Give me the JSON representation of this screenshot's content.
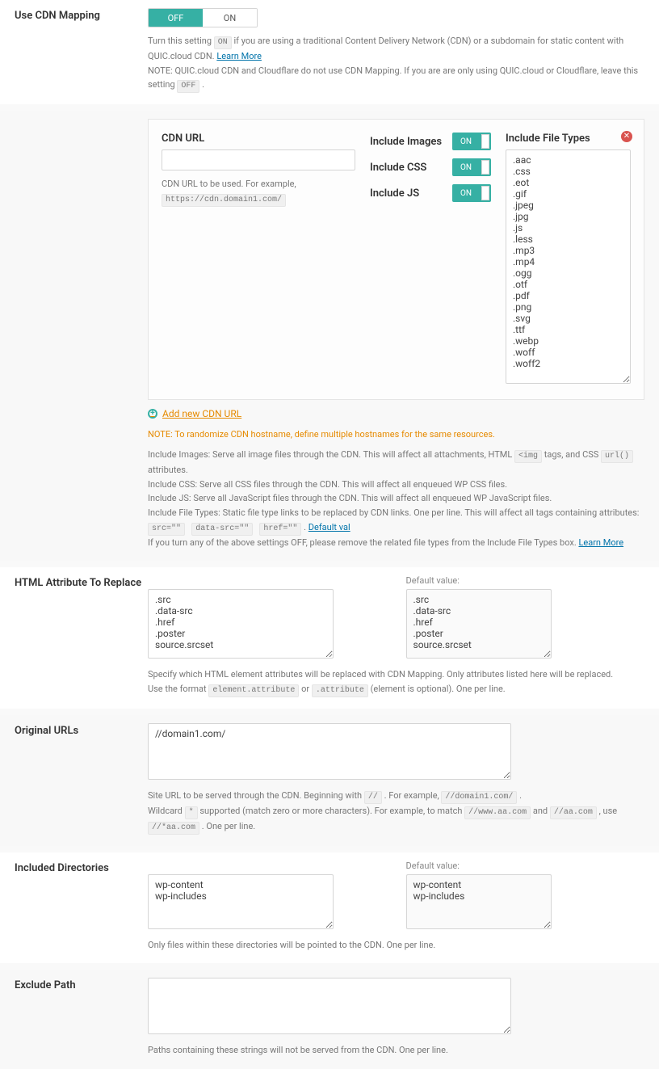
{
  "useCdnMapping": {
    "label": "Use CDN Mapping",
    "off": "OFF",
    "on": "ON",
    "help1_pre": "Turn this setting ",
    "help1_pill": "ON",
    "help1_post": " if you are using a traditional Content Delivery Network (CDN) or a subdomain for static content with QUIC.cloud CDN. ",
    "learnMore": "Learn More",
    "help2_pre": "NOTE: QUIC.cloud CDN and Cloudflare do not use CDN Mapping. If you are are only using QUIC.cloud or Cloudflare, leave this setting ",
    "help2_pill": "OFF",
    "help2_post": " ."
  },
  "cdnBlock": {
    "cdnUrl": {
      "label": "CDN URL",
      "value": "",
      "helpPre": "CDN URL to be used. For example, ",
      "helpCode": "https://cdn.domain1.com/"
    },
    "includeImages": {
      "label": "Include Images",
      "state": "ON"
    },
    "includeCss": {
      "label": "Include CSS",
      "state": "ON"
    },
    "includeJs": {
      "label": "Include JS",
      "state": "ON"
    },
    "includeFileTypes": {
      "label": "Include File Types",
      "value": ".aac\n.css\n.eot\n.gif\n.jpeg\n.jpg\n.js\n.less\n.mp3\n.mp4\n.ogg\n.otf\n.pdf\n.png\n.svg\n.ttf\n.webp\n.woff\n.woff2"
    },
    "addNew": "Add new CDN URL",
    "randomizeNote": "NOTE: To randomize CDN hostname, define multiple hostnames for the same resources.",
    "desc": {
      "images_pre": "Include Images: Serve all image files through the CDN. This will affect all attachments, HTML ",
      "images_code1": "<img",
      "images_mid": " tags, and CSS ",
      "images_code2": "url()",
      "images_post": " attributes.",
      "css": "Include CSS: Serve all CSS files through the CDN. This will affect all enqueued WP CSS files.",
      "js": "Include JS: Serve all JavaScript files through the CDN. This will affect all enqueued WP JavaScript files.",
      "ft_pre": "Include File Types: Static file type links to be replaced by CDN links. One per line. This will affect all tags containing attributes: ",
      "ft_c1": "src=\"\"",
      "ft_c2": "data-src=\"\"",
      "ft_c3": "href=\"\"",
      "ft_post": ". ",
      "defaultVal": "Default val",
      "off_pre": "If you turn any of the above settings OFF, please remove the related file types from the Include File Types box. ",
      "learnMore": "Learn More"
    }
  },
  "htmlAttr": {
    "label": "HTML Attribute To Replace",
    "value": ".src\n.data-src\n.href\n.poster\nsource.srcset",
    "defaultLabel": "Default value:",
    "defaultValue": ".src\n.data-src\n.href\n.poster\nsource.srcset",
    "help1": "Specify which HTML element attributes will be replaced with CDN Mapping. Only attributes listed here will be replaced.",
    "help2_pre": "Use the format ",
    "help2_c1": "element.attribute",
    "help2_mid": " or ",
    "help2_c2": ".attribute",
    "help2_post": " (element is optional). One per line."
  },
  "originalUrls": {
    "label": "Original URLs",
    "value": "//domain1.com/",
    "help1_pre": "Site URL to be served through the CDN. Beginning with ",
    "help1_c1": "//",
    "help1_mid": " . For example, ",
    "help1_c2": "//domain1.com/",
    "help1_post": " .",
    "help2_pre": "Wildcard ",
    "help2_c1": "*",
    "help2_mid1": " supported (match zero or more characters). For example, to match ",
    "help2_c2": "//www.aa.com",
    "help2_mid2": " and ",
    "help2_c3": "//aa.com",
    "help2_mid3": " , use ",
    "help2_c4": "//*aa.com",
    "help2_post": " . One per line."
  },
  "includedDirs": {
    "label": "Included Directories",
    "value": "wp-content\nwp-includes",
    "defaultLabel": "Default value:",
    "defaultValue": "wp-content\nwp-includes",
    "help": "Only files within these directories will be pointed to the CDN. One per line."
  },
  "excludePath": {
    "label": "Exclude Path",
    "value": "",
    "help": "Paths containing these strings will not be served from the CDN. One per line."
  }
}
